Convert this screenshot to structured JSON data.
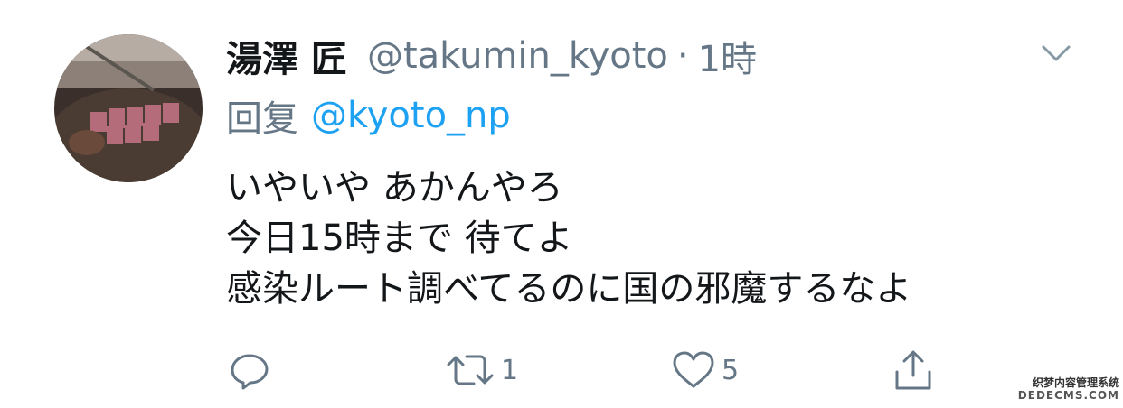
{
  "tweet": {
    "display_name": "湯澤 匠",
    "handle": "@takumin_kyoto",
    "separator": "·",
    "time": "1時",
    "reply_label": "回复",
    "reply_mention": "@kyoto_np",
    "lines": [
      "いやいや あかんやろ",
      "今日15時まで 待てよ",
      "感染ルート調べてるのに国の邪魔するなよ"
    ]
  },
  "actions": {
    "reply_icon": "reply-icon",
    "retweet_icon": "retweet-icon",
    "retweet_count": "1",
    "like_icon": "heart-icon",
    "like_count": "5",
    "share_icon": "share-icon"
  },
  "watermark": {
    "top": "织梦内容管理系统",
    "bottom": "DEDECMS.COM"
  },
  "colors": {
    "text": "#14171a",
    "secondary": "#657786",
    "link": "#1da1f2"
  }
}
